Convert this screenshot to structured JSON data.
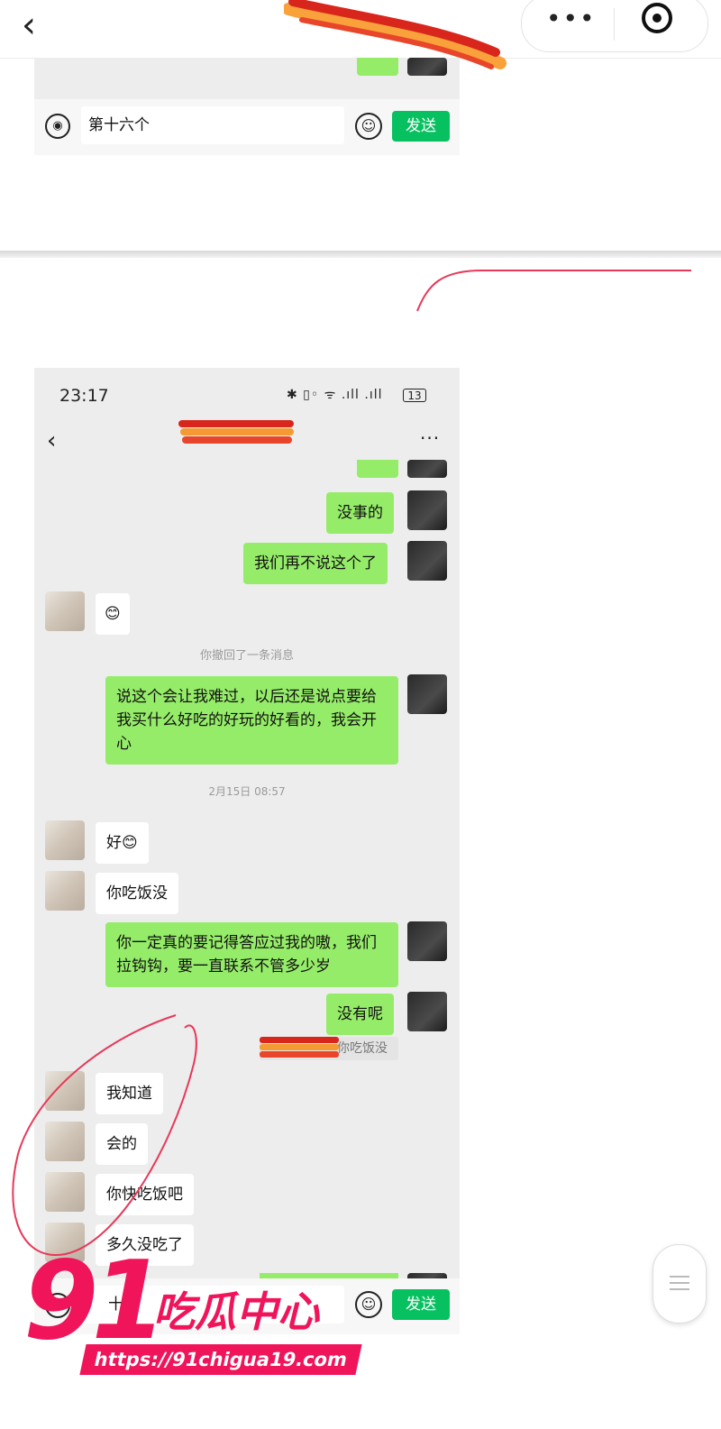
{
  "mini_program_bar": {
    "back_glyph": "‹",
    "more_glyph": "•••",
    "capsule_icons": [
      "more-icon",
      "target-icon"
    ]
  },
  "first_fragment": {
    "input_value": "第十六个",
    "send_label": "发送"
  },
  "chat": {
    "status_bar": {
      "time": "23:17",
      "icons": "✱ ▯◦ ᯤ .ıll .ıll",
      "battery": "13"
    },
    "nav": {
      "back_glyph": "‹",
      "more_glyph": "···"
    },
    "messages": [
      {
        "side": "out",
        "text": "没事的"
      },
      {
        "side": "out",
        "text": "我们再不说这个了"
      },
      {
        "side": "in",
        "text": "😊"
      },
      {
        "side": "system",
        "text": "你撤回了一条消息"
      },
      {
        "side": "out",
        "text": "说这个会让我难过，以后还是说点要给我买什么好吃的好玩的好看的，我会开心"
      },
      {
        "side": "system",
        "text": "2月15日 08:57"
      },
      {
        "side": "in",
        "text": "好😊"
      },
      {
        "side": "in",
        "text": "你吃饭没"
      },
      {
        "side": "out",
        "text": "你一定真的要记得答应过我的嗷，我们拉钩钩，要一直联系不管多少岁"
      },
      {
        "side": "out",
        "text": "没有呢"
      },
      {
        "side": "quote",
        "text": "你吃饭没"
      },
      {
        "side": "in",
        "text": "我知道"
      },
      {
        "side": "in",
        "text": "会的"
      },
      {
        "side": "in",
        "text": "你快吃饭吧"
      },
      {
        "side": "in",
        "text": "多久没吃了"
      }
    ],
    "input_prefix": "十",
    "send_label": "发送"
  },
  "watermark": {
    "number": "91",
    "brand": "吃瓜中心",
    "url": "https://91chigua19.com"
  },
  "colors": {
    "wechat_green_bubble": "#95ec69",
    "send_button": "#07c160",
    "chat_background": "#ededed",
    "watermark": "#f0145a",
    "annotation_ink": "#e8385a"
  }
}
